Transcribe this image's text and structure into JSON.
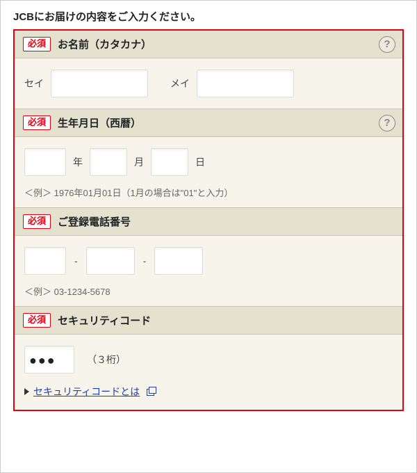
{
  "page": {
    "title": "JCBにお届けの内容をご入力ください。"
  },
  "badge": {
    "required": "必須"
  },
  "sections": {
    "name": {
      "label": "お名前（カタカナ）",
      "sei_label": "セイ",
      "mei_label": "メイ"
    },
    "dob": {
      "label": "生年月日（西暦）",
      "year_unit": "年",
      "month_unit": "月",
      "day_unit": "日",
      "example": "＜例＞ 1976年01月01日（1月の場合は\"01\"と入力）"
    },
    "phone": {
      "label": "ご登録電話番号",
      "sep": "-",
      "example": "＜例＞ 03-1234-5678"
    },
    "cvv": {
      "label": "セキュリティコード",
      "masked_value": "●●●",
      "note": "（３桁）",
      "link_text": "セキュリティコードとは"
    }
  }
}
